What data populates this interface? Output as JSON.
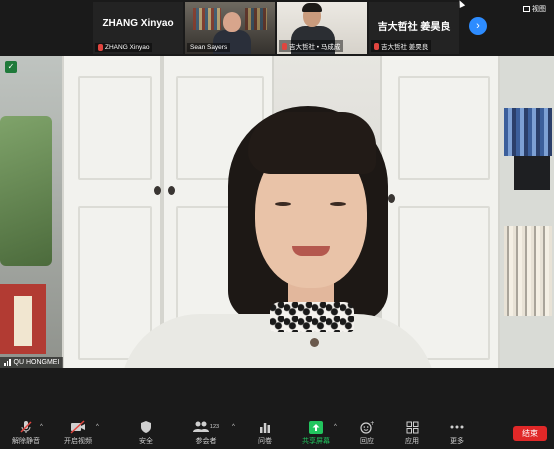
{
  "top_strip": {
    "tiles": [
      {
        "big_name": "ZHANG Xinyao",
        "label": "ZHANG Xinyao"
      },
      {
        "label": "Sean Sayers"
      },
      {
        "label": "吉大哲社 • 马成成"
      },
      {
        "big_name": "吉大哲社 姜昊良",
        "label": "吉大哲社 姜昊良"
      }
    ],
    "view_label": "视图"
  },
  "main_video": {
    "speaker_name": "QU HONGMEI"
  },
  "toolbar": {
    "items": [
      {
        "label": "解除静音",
        "icon": "mic-muted-icon"
      },
      {
        "label": "开启视频",
        "icon": "video-off-icon"
      },
      {
        "label": "安全",
        "icon": "shield-icon"
      },
      {
        "label": "参会者",
        "icon": "participants-icon",
        "count": "123"
      },
      {
        "label": "问卷",
        "icon": "poll-icon"
      },
      {
        "label": "共享屏幕",
        "icon": "share-screen-icon"
      },
      {
        "label": "回应",
        "icon": "reaction-icon"
      },
      {
        "label": "应用",
        "icon": "apps-icon"
      },
      {
        "label": "更多",
        "icon": "more-icon"
      }
    ],
    "end_label": "结束"
  },
  "colors": {
    "share_green": "#22c55e",
    "end_red": "#e02828",
    "accent_blue": "#2d8cff",
    "muted_red": "#e0453f"
  }
}
